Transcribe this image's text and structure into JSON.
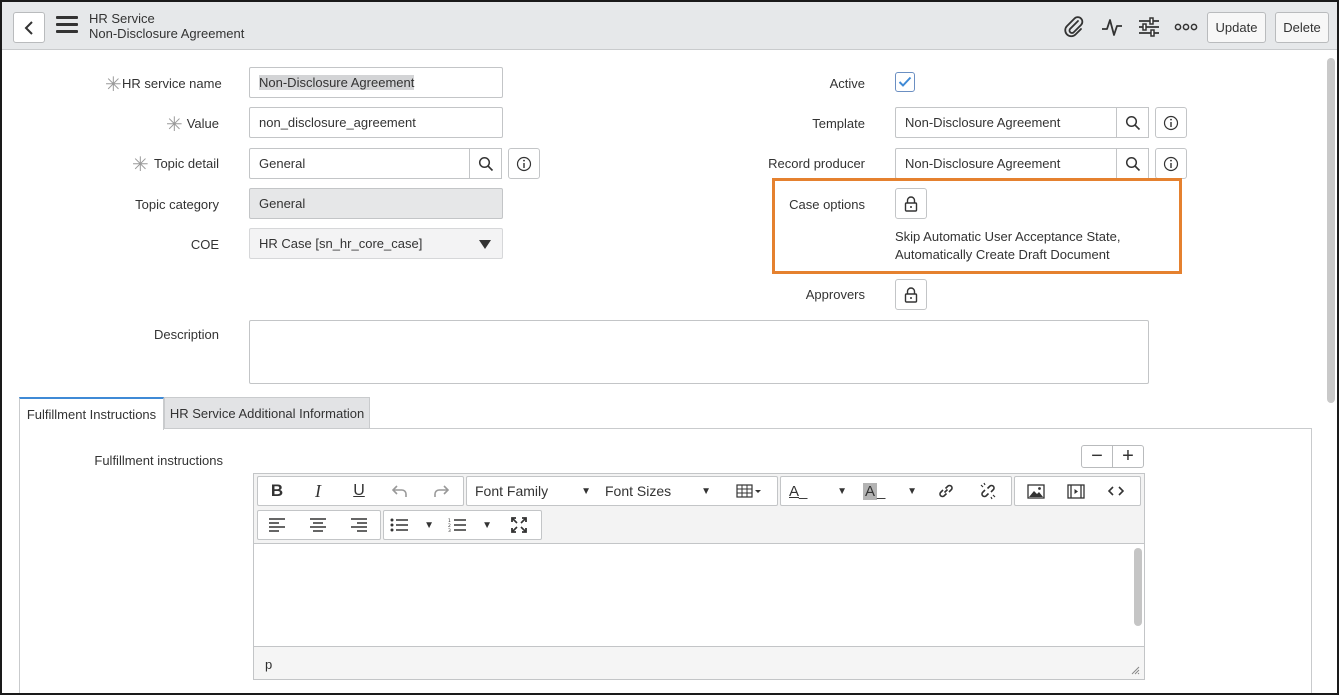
{
  "header": {
    "title_line1": "HR Service",
    "title_line2": "Non-Disclosure Agreement",
    "update_label": "Update",
    "delete_label": "Delete"
  },
  "form": {
    "hr_service_name": {
      "label": "HR service name",
      "value": "Non-Disclosure Agreement"
    },
    "value": {
      "label": "Value",
      "value": "non_disclosure_agreement"
    },
    "topic_detail": {
      "label": "Topic detail",
      "value": "General"
    },
    "topic_category": {
      "label": "Topic category",
      "value": "General"
    },
    "coe": {
      "label": "COE",
      "value": "HR Case [sn_hr_core_case]"
    },
    "active": {
      "label": "Active",
      "checked": true
    },
    "template": {
      "label": "Template",
      "value": "Non-Disclosure Agreement"
    },
    "record_producer": {
      "label": "Record producer",
      "value": "Non-Disclosure Agreement"
    },
    "case_options": {
      "label": "Case options",
      "text_line1": "Skip Automatic User Acceptance State,",
      "text_line2": "Automatically Create Draft Document"
    },
    "approvers": {
      "label": "Approvers"
    },
    "description": {
      "label": "Description",
      "value": ""
    }
  },
  "tabs": [
    {
      "label": "Fulfillment Instructions",
      "active": true
    },
    {
      "label": "HR Service Additional Information",
      "active": false
    }
  ],
  "fulfillment": {
    "label": "Fulfillment instructions",
    "editor": {
      "font_family": "Font Family",
      "font_sizes": "Font Sizes",
      "status_path": "p"
    }
  },
  "colors": {
    "highlight": "#e5812f",
    "active_tab": "#3f8ad6",
    "checkbox": "#3f8ad6"
  }
}
